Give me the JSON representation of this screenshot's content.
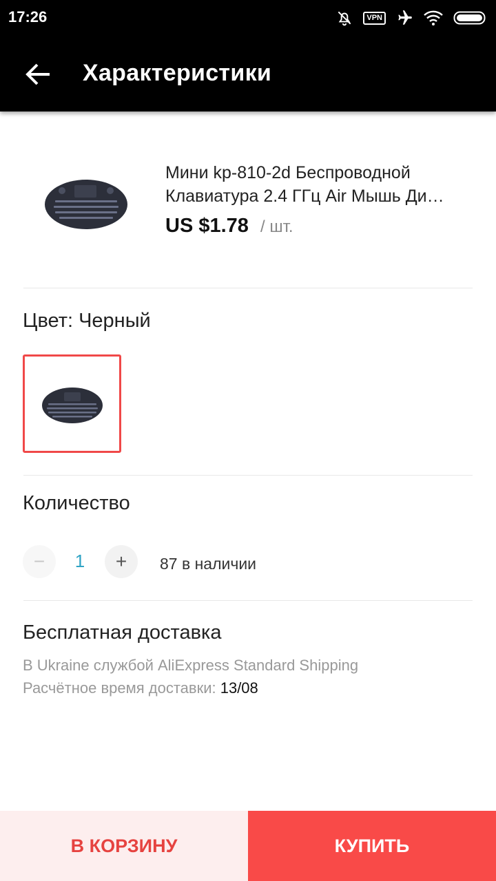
{
  "status_bar": {
    "time": "17:26",
    "vpn_label": "VPN",
    "icons": [
      "bell-off-icon",
      "vpn-icon",
      "airplane-icon",
      "wifi-icon",
      "battery-icon"
    ]
  },
  "app_bar": {
    "title": "Характеристики",
    "back_icon": "arrow-left-icon"
  },
  "product": {
    "title_line1": "Мини kp-810-2d Беспроводной",
    "title_line2": "Клавиатура 2.4 ГГц Air Мышь Ди…",
    "price": "US $1.78",
    "unit": "/ шт."
  },
  "color": {
    "label": "Цвет: Черный",
    "selected_swatch": "keyboard-black"
  },
  "quantity": {
    "label": "Количество",
    "minus": "−",
    "value": "1",
    "plus": "+",
    "stock": "87 в наличии"
  },
  "shipping": {
    "title": "Бесплатная доставка",
    "line1": "В Ukraine службой AliExpress Standard Shipping",
    "line2_prefix": "Расчётное время доставки: ",
    "line2_date": "13/08"
  },
  "actions": {
    "cart": "В КОРЗИНУ",
    "buy": "КУПИТЬ"
  },
  "colors": {
    "accent": "#f94a48",
    "cart_bg": "#fdeeee",
    "qty_value": "#2fa3c4"
  }
}
